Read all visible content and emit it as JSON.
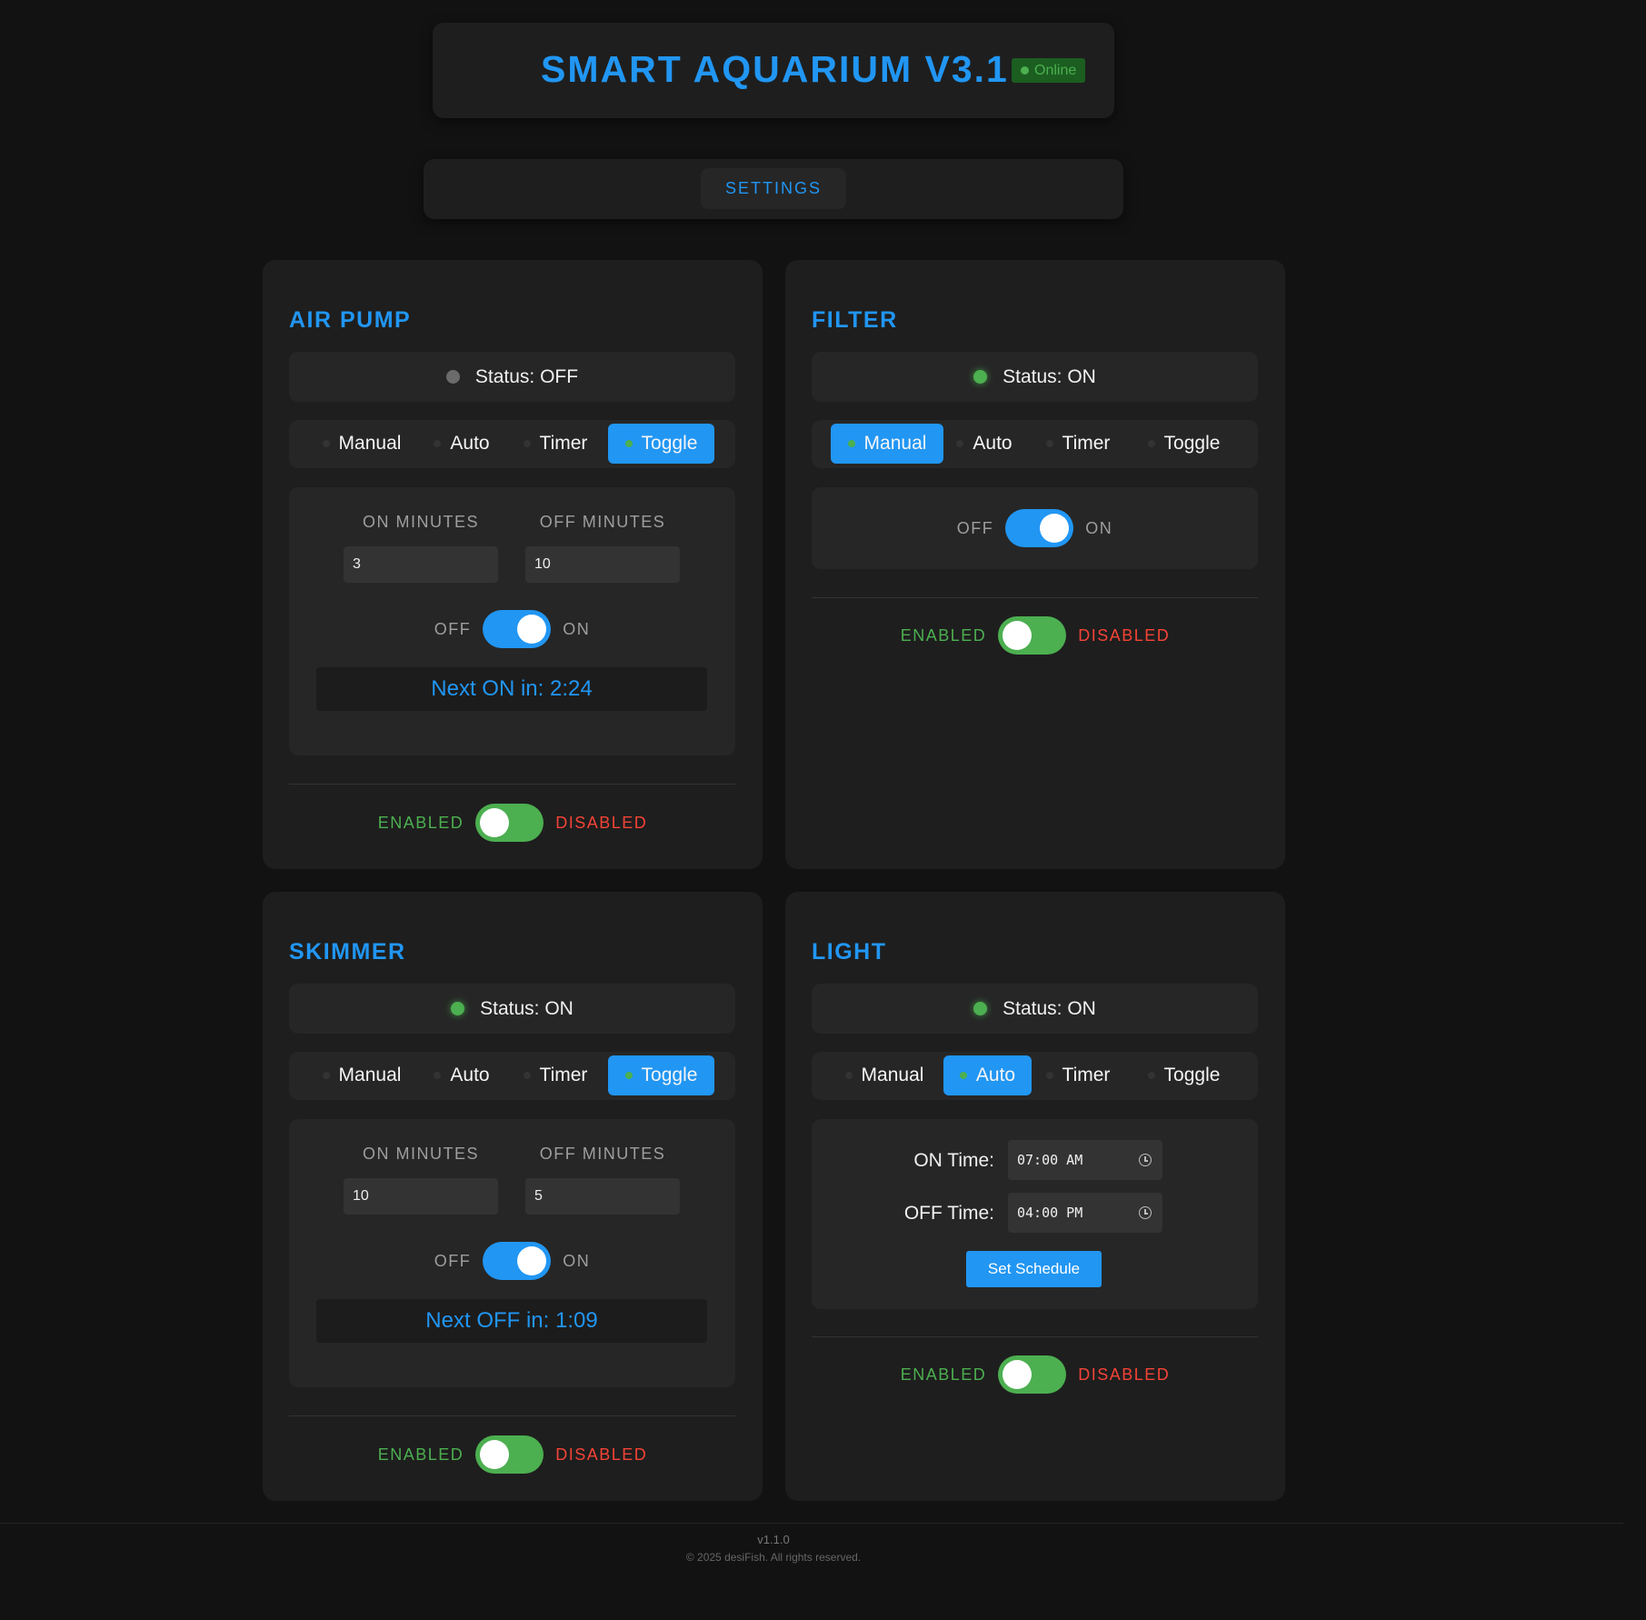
{
  "header": {
    "title": "SMART AQUARIUM V3.1",
    "status_badge": "Online"
  },
  "nav": {
    "settings_label": "SETTINGS"
  },
  "modes": [
    "Manual",
    "Auto",
    "Timer",
    "Toggle"
  ],
  "cards": {
    "air_pump": {
      "title": "AIR PUMP",
      "status": "Status: OFF",
      "active_mode": "Toggle",
      "on_minutes_label": "ON MINUTES",
      "off_minutes_label": "OFF MINUTES",
      "on_minutes": "3",
      "off_minutes": "10",
      "switch_off_label": "OFF",
      "switch_on_label": "ON",
      "countdown": "Next ON in: 2:24",
      "enabled_label": "ENABLED",
      "disabled_label": "DISABLED"
    },
    "filter": {
      "title": "FILTER",
      "status": "Status: ON",
      "active_mode": "Manual",
      "switch_off_label": "OFF",
      "switch_on_label": "ON",
      "enabled_label": "ENABLED",
      "disabled_label": "DISABLED"
    },
    "skimmer": {
      "title": "SKIMMER",
      "status": "Status: ON",
      "active_mode": "Toggle",
      "on_minutes_label": "ON MINUTES",
      "off_minutes_label": "OFF MINUTES",
      "on_minutes": "10",
      "off_minutes": "5",
      "switch_off_label": "OFF",
      "switch_on_label": "ON",
      "countdown": "Next OFF in: 1:09",
      "enabled_label": "ENABLED",
      "disabled_label": "DISABLED"
    },
    "light": {
      "title": "LIGHT",
      "status": "Status: ON",
      "active_mode": "Auto",
      "on_time_label": "ON Time:",
      "off_time_label": "OFF Time:",
      "on_time": "07:00 AM",
      "off_time": "04:00 PM",
      "set_schedule_label": "Set Schedule",
      "enabled_label": "ENABLED",
      "disabled_label": "DISABLED"
    }
  },
  "footer": {
    "version": "v1.1.0",
    "copyright": "© 2025 desiFish. All rights reserved."
  },
  "colors": {
    "accent": "#2196f3",
    "on": "#4caf50",
    "off_red": "#f44336",
    "card": "#1e1e1e",
    "background": "#121212"
  }
}
